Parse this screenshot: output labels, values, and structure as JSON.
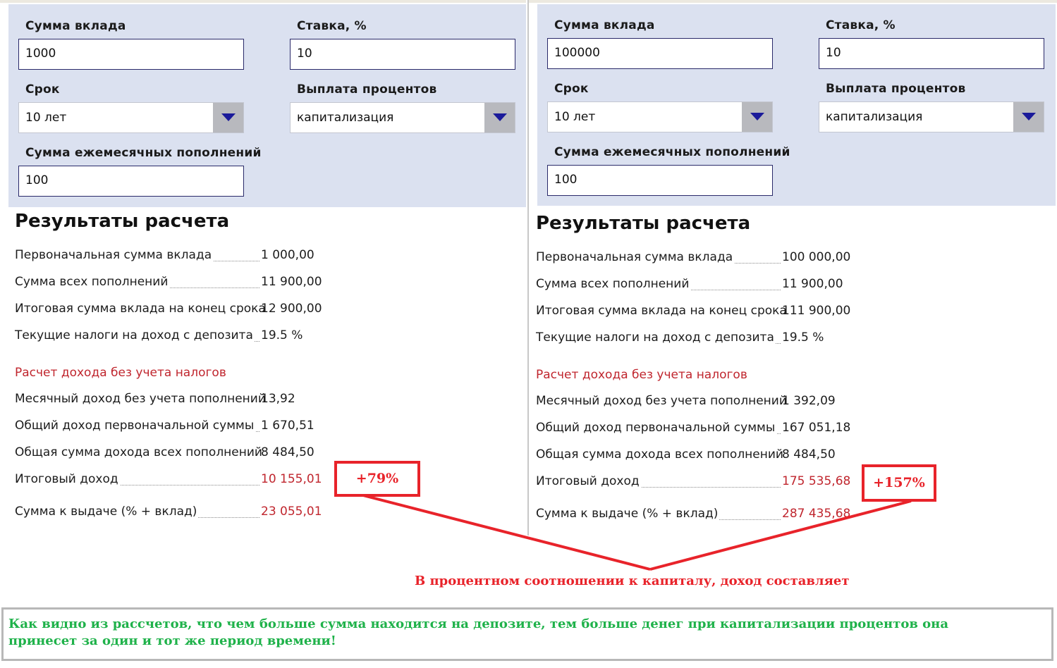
{
  "left": {
    "form": {
      "amount_label": "Сумма вклада",
      "amount_value": "1000",
      "rate_label": "Ставка, %",
      "rate_value": "10",
      "term_label": "Срок",
      "term_value": "10 лет",
      "payout_label": "Выплата процентов",
      "payout_value": "капитализация",
      "topup_label": "Сумма ежемесячных пополнений",
      "topup_value": "100"
    },
    "results": {
      "title": "Результаты расчета",
      "rows": [
        {
          "label": "Первоначальная сумма вклада",
          "value": "1 000,00"
        },
        {
          "label": "Сумма всех пополнений",
          "value": "11 900,00"
        },
        {
          "label": "Итоговая сумма вклада на конец срока",
          "value": "12 900,00"
        },
        {
          "label": "Текущие налоги на доход с депозита",
          "value": "19.5 %"
        }
      ],
      "subheading": "Расчет дохода без учета налогов",
      "income_rows": [
        {
          "label": "Месячный доход без учета пополнений",
          "value": "13,92"
        },
        {
          "label": "Общий доход первоначальной суммы",
          "value": "1 670,51"
        },
        {
          "label": "Общая сумма дохода всех пополнений",
          "value": "8 484,50"
        },
        {
          "label": "Итоговый доход",
          "value": "10 155,01"
        },
        {
          "label": "Сумма к выдаче (% + вклад)",
          "value": "23 055,01"
        }
      ]
    },
    "callout": "+79%"
  },
  "right": {
    "form": {
      "amount_label": "Сумма вклада",
      "amount_value": "100000",
      "rate_label": "Ставка, %",
      "rate_value": "10",
      "term_label": "Срок",
      "term_value": "10 лет",
      "payout_label": "Выплата процентов",
      "payout_value": "капитализация",
      "topup_label": "Сумма ежемесячных пополнений",
      "topup_value": "100"
    },
    "results": {
      "title": "Результаты расчета",
      "rows": [
        {
          "label": "Первоначальная сумма вклада",
          "value": "100 000,00"
        },
        {
          "label": "Сумма всех пополнений",
          "value": "11 900,00"
        },
        {
          "label": "Итоговая сумма вклада на конец срока",
          "value": "111 900,00"
        },
        {
          "label": "Текущие налоги на доход с депозита",
          "value": "19.5 %"
        }
      ],
      "subheading": "Расчет дохода без учета налогов",
      "income_rows": [
        {
          "label": "Месячный доход без учета пополнений",
          "value": "1 392,09"
        },
        {
          "label": "Общий доход первоначальной суммы",
          "value": "167 051,18"
        },
        {
          "label": "Общая сумма дохода всех пополнений",
          "value": "8 484,50"
        },
        {
          "label": "Итоговый доход",
          "value": "175 535,68"
        },
        {
          "label": "Сумма к выдаче (% + вклад)",
          "value": "287 435,68"
        }
      ]
    },
    "callout": "+157%"
  },
  "annotation": {
    "caption": "В процентном соотношении к капиталу, доход составляет",
    "conclusion": "Как видно из рассчетов, что чем больше сумма находится на депозите, тем больше денег при капитализации процентов она принесет за один и тот же период времени!"
  },
  "colors": {
    "form_bg": "#dbe1f0",
    "accent_red": "#c0262e",
    "annotation_red": "#e8232a",
    "conclusion_green": "#1fb24a",
    "dropdown_arrow": "#1a1a9a"
  }
}
